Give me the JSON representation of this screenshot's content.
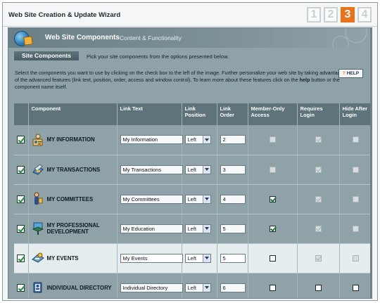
{
  "window": {
    "title": "Web Site Creation & Update Wizard"
  },
  "steps": [
    {
      "label": "1",
      "active": false
    },
    {
      "label": "2",
      "active": false
    },
    {
      "label": "3",
      "active": true
    },
    {
      "label": "4",
      "active": false
    }
  ],
  "banner": {
    "heading": "Web Site Components",
    "subheading": "Content & Functionality"
  },
  "section": {
    "tab_label": "Site Components",
    "note": "Pick your site components from the options presented below."
  },
  "intro": {
    "text_before": "Select the components you want to use by clicking on the check box to the left of the image. Further personalize your web site by taking advantage of the advanced features (link text, position, order, access and window control). To learn more about these features click on the ",
    "help_word": "help",
    "text_after": " button or the component name itself."
  },
  "help_button": {
    "label": "HELP",
    "icon": "question-icon"
  },
  "table": {
    "headers": {
      "component": "Component",
      "link_text": "Link Text",
      "link_position": "Link Position",
      "link_order": "Link Order",
      "member_only": "Member-Only Access",
      "requires_login": "Requires Login",
      "hide_after_login": "Hide After Login"
    },
    "rows": [
      {
        "name": "MY INFORMATION",
        "icon": "id-card-icon",
        "selected": true,
        "link_text": "My Information",
        "position": "Left",
        "order": "2",
        "member_only": {
          "checked": false,
          "disabled": true
        },
        "requires_login": {
          "checked": true,
          "disabled": true
        },
        "hide_after_login": {
          "checked": false,
          "disabled": true
        }
      },
      {
        "name": "MY TRANSACTIONS",
        "icon": "transactions-icon",
        "selected": true,
        "link_text": "My Transactions",
        "position": "Left",
        "order": "3",
        "member_only": {
          "checked": false,
          "disabled": true
        },
        "requires_login": {
          "checked": true,
          "disabled": true
        },
        "hide_after_login": {
          "checked": false,
          "disabled": true
        }
      },
      {
        "name": "MY COMMITTEES",
        "icon": "committee-icon",
        "selected": true,
        "link_text": "My Committees",
        "position": "Left",
        "order": "4",
        "member_only": {
          "checked": true,
          "disabled": false
        },
        "requires_login": {
          "checked": true,
          "disabled": true
        },
        "hide_after_login": {
          "checked": false,
          "disabled": true
        }
      },
      {
        "name": "MY PROFESSIONAL DEVELOPMENT",
        "icon": "education-icon",
        "selected": true,
        "link_text": "My Education",
        "position": "Left",
        "order": "5",
        "member_only": {
          "checked": true,
          "disabled": false
        },
        "requires_login": {
          "checked": true,
          "disabled": true
        },
        "hide_after_login": {
          "checked": false,
          "disabled": true
        }
      },
      {
        "name": "MY EVENTS",
        "icon": "events-icon",
        "selected": true,
        "link_text": "My Events",
        "position": "Left",
        "order": "5",
        "member_only": {
          "checked": false,
          "disabled": false
        },
        "requires_login": {
          "checked": true,
          "disabled": true
        },
        "hide_after_login": {
          "checked": false,
          "disabled": true
        },
        "highlight": true
      },
      {
        "name": "INDIVIDUAL DIRECTORY",
        "icon": "directory-icon",
        "selected": true,
        "link_text": "Individual Directory",
        "position": "Left",
        "order": "6",
        "member_only": {
          "checked": false,
          "disabled": false
        },
        "requires_login": {
          "checked": false,
          "disabled": false
        },
        "hide_after_login": {
          "checked": false,
          "disabled": false
        }
      }
    ]
  },
  "colors": {
    "accent_step": "#e8731a",
    "panel": "#8fa2a8",
    "header": "#5e737a",
    "highlight_row": "#e6edef"
  }
}
